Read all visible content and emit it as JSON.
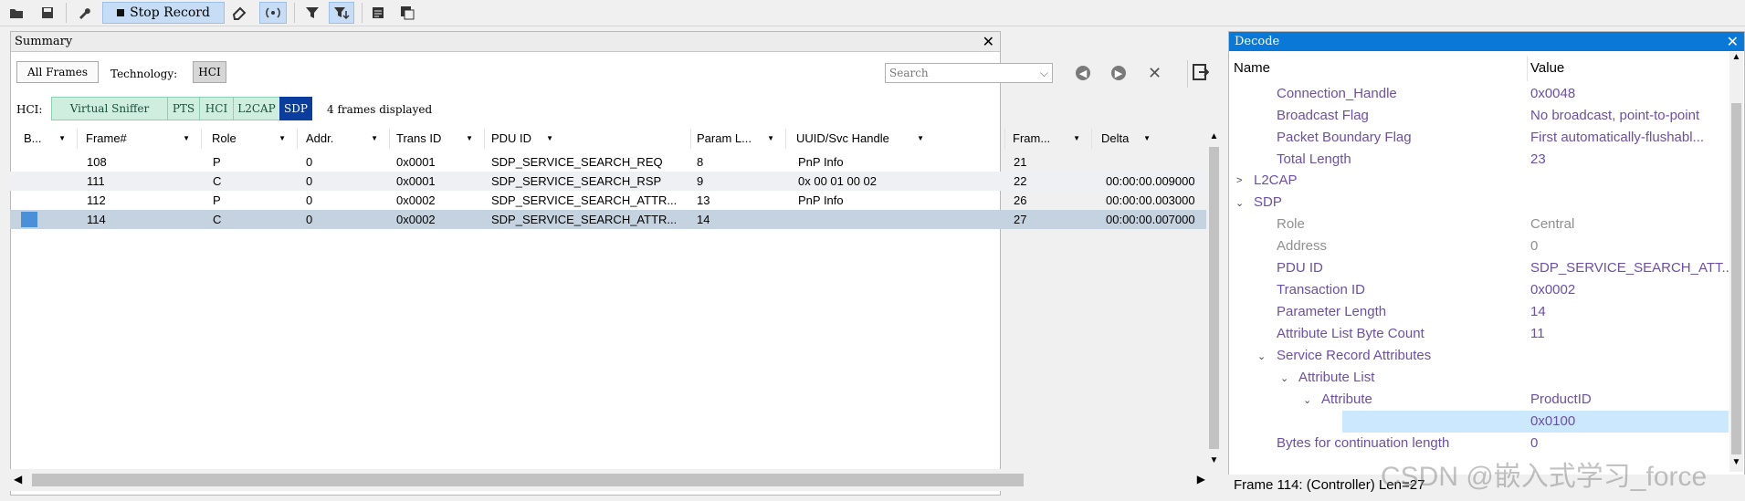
{
  "toolbar": {
    "stop_record_label": "Stop Record"
  },
  "summary": {
    "title": "Summary",
    "all_frames_label": "All Frames",
    "technology_label": "Technology:",
    "technology_value": "HCI",
    "search_placeholder": "Search",
    "hci_label": "HCI:",
    "protocols": [
      "Virtual Sniffer",
      "PTS",
      "HCI",
      "L2CAP",
      "SDP"
    ],
    "frames_displayed": "4 frames displayed",
    "columns": [
      "B...",
      "Frame#",
      "Role",
      "Addr.",
      "Trans ID",
      "PDU ID",
      "Param L...",
      "UUID/Svc Handle",
      "Fram...",
      "Delta"
    ],
    "rows": [
      [
        "",
        "108",
        "P",
        "0",
        "0x0001",
        "SDP_SERVICE_SEARCH_REQ",
        "8",
        "PnP Info",
        "21",
        ""
      ],
      [
        "",
        "111",
        "C",
        "0",
        "0x0001",
        "SDP_SERVICE_SEARCH_RSP",
        "9",
        "0x 00 01 00 02",
        "22",
        "00:00:00.009000"
      ],
      [
        "",
        "112",
        "P",
        "0",
        "0x0002",
        "SDP_SERVICE_SEARCH_ATTR...",
        "13",
        "PnP Info",
        "26",
        "00:00:00.003000"
      ],
      [
        "",
        "114",
        "C",
        "0",
        "0x0002",
        "SDP_SERVICE_SEARCH_ATTR...",
        "14",
        "",
        "27",
        "00:00:00.007000"
      ]
    ]
  },
  "decode": {
    "title": "Decode",
    "col_name": "Name",
    "col_value": "Value",
    "items": [
      {
        "name": "Connection_Handle",
        "value": "0x0048"
      },
      {
        "name": "Broadcast Flag",
        "value": "No broadcast, point-to-point"
      },
      {
        "name": "Packet Boundary Flag",
        "value": "First automatically-flushabl..."
      },
      {
        "name": "Total Length",
        "value": "23"
      },
      {
        "name": "L2CAP",
        "value": ""
      },
      {
        "name": "SDP",
        "value": ""
      },
      {
        "name": "Role",
        "value": "Central"
      },
      {
        "name": "Address",
        "value": "0"
      },
      {
        "name": "PDU ID",
        "value": "SDP_SERVICE_SEARCH_ATT..."
      },
      {
        "name": "Transaction ID",
        "value": "0x0002"
      },
      {
        "name": "Parameter Length",
        "value": "14"
      },
      {
        "name": "Attribute List Byte Count",
        "value": "11"
      },
      {
        "name": "Service Record Attributes",
        "value": ""
      },
      {
        "name": "Attribute List",
        "value": ""
      },
      {
        "name": "Attribute",
        "value": "ProductID"
      },
      {
        "name": "",
        "value": "0x0100"
      },
      {
        "name": "Bytes for continuation length",
        "value": "0"
      }
    ]
  },
  "status": "Frame 114: (Controller) Len=27",
  "watermark": "CSDN @嵌入式学习_force",
  "colors": {
    "accent": "#0a78d7",
    "selected_row": "#c5d3e1",
    "proto_bg": "#cfeee0",
    "sdp_selected": "#0b3d9e"
  }
}
